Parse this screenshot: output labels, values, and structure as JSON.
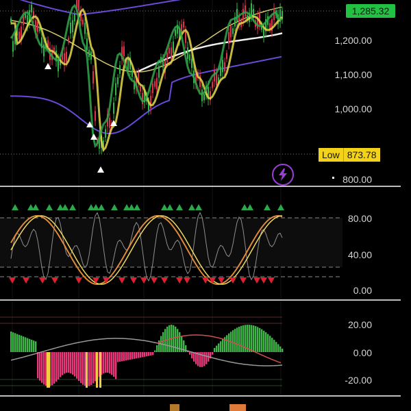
{
  "price_axis": {
    "current_price": "1,285.32",
    "ticks": [
      "1,200.00",
      "1,100.00",
      "1,000.00",
      "800.00"
    ],
    "low": {
      "label": "Low",
      "value": "873.78"
    }
  },
  "oscillator_axis": {
    "ticks": [
      "80.00",
      "40.00",
      "0.00"
    ]
  },
  "macd_axis": {
    "ticks": [
      "20.00",
      "0.00",
      "-20.00"
    ]
  },
  "colors": {
    "background": "#000000",
    "up": "#2fb84a",
    "down": "#e0304a",
    "wave_yellow": "#e8d84a",
    "wave_green": "#2fa64a",
    "band": "#6a4ad8",
    "ma_white": "#f0f0f0",
    "hist_pos": "#3fb54a",
    "hist_neg": "#e83a7a",
    "current_badge": "#22c043",
    "low_badge": "#f3d21a",
    "bolt": "#9a3fd8"
  },
  "icons": {
    "lightning_button": "lightning-icon"
  }
}
